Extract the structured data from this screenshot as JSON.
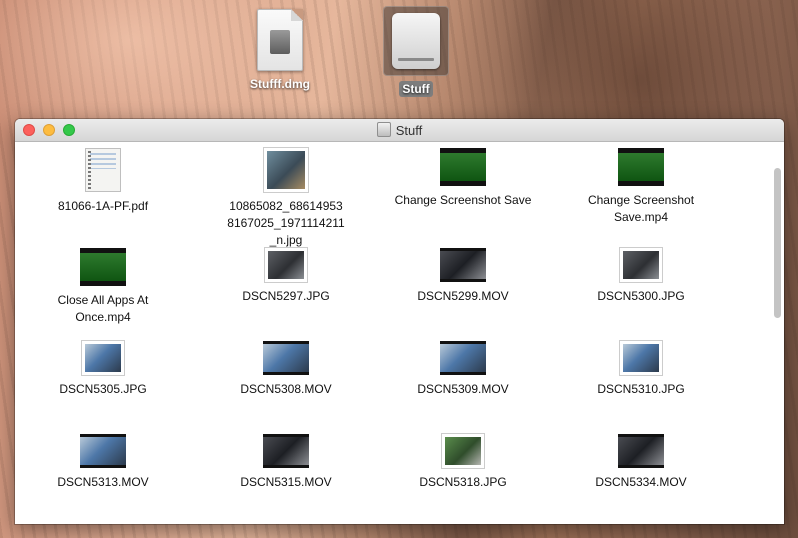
{
  "desktop": {
    "icons": [
      {
        "label": "Stufff.dmg"
      },
      {
        "label": "Stuff",
        "selected": true
      }
    ]
  },
  "window": {
    "title": "Stuff",
    "files": [
      {
        "name": "81066-1A-PF.pdf",
        "icon": "pdf-document-icon"
      },
      {
        "name": "10865082_686149538167025_1971114211_n.jpg",
        "icon": "photo-thumbnail-icon"
      },
      {
        "name": "Change Screenshot Save",
        "icon": "video-thumbnail-icon"
      },
      {
        "name": "Change Screenshot Save.mp4",
        "icon": "video-thumbnail-icon"
      },
      {
        "name": "Close All Apps At Once.mp4",
        "icon": "video-thumbnail-icon"
      },
      {
        "name": "DSCN5297.JPG",
        "icon": "photo-thumbnail-icon"
      },
      {
        "name": "DSCN5299.MOV",
        "icon": "video-thumbnail-icon"
      },
      {
        "name": "DSCN5300.JPG",
        "icon": "photo-thumbnail-icon"
      },
      {
        "name": "DSCN5305.JPG",
        "icon": "photo-thumbnail-icon"
      },
      {
        "name": "DSCN5308.MOV",
        "icon": "video-thumbnail-icon"
      },
      {
        "name": "DSCN5309.MOV",
        "icon": "video-thumbnail-icon"
      },
      {
        "name": "DSCN5310.JPG",
        "icon": "photo-thumbnail-icon"
      },
      {
        "name": "DSCN5313.MOV",
        "icon": "video-thumbnail-icon"
      },
      {
        "name": "DSCN5315.MOV",
        "icon": "video-thumbnail-icon"
      },
      {
        "name": "DSCN5318.JPG",
        "icon": "photo-thumbnail-icon"
      },
      {
        "name": "DSCN5334.MOV",
        "icon": "video-thumbnail-icon"
      }
    ]
  },
  "colors": {
    "close": "#fc605c",
    "minimize": "#fdbc40",
    "zoom": "#34c84a"
  }
}
